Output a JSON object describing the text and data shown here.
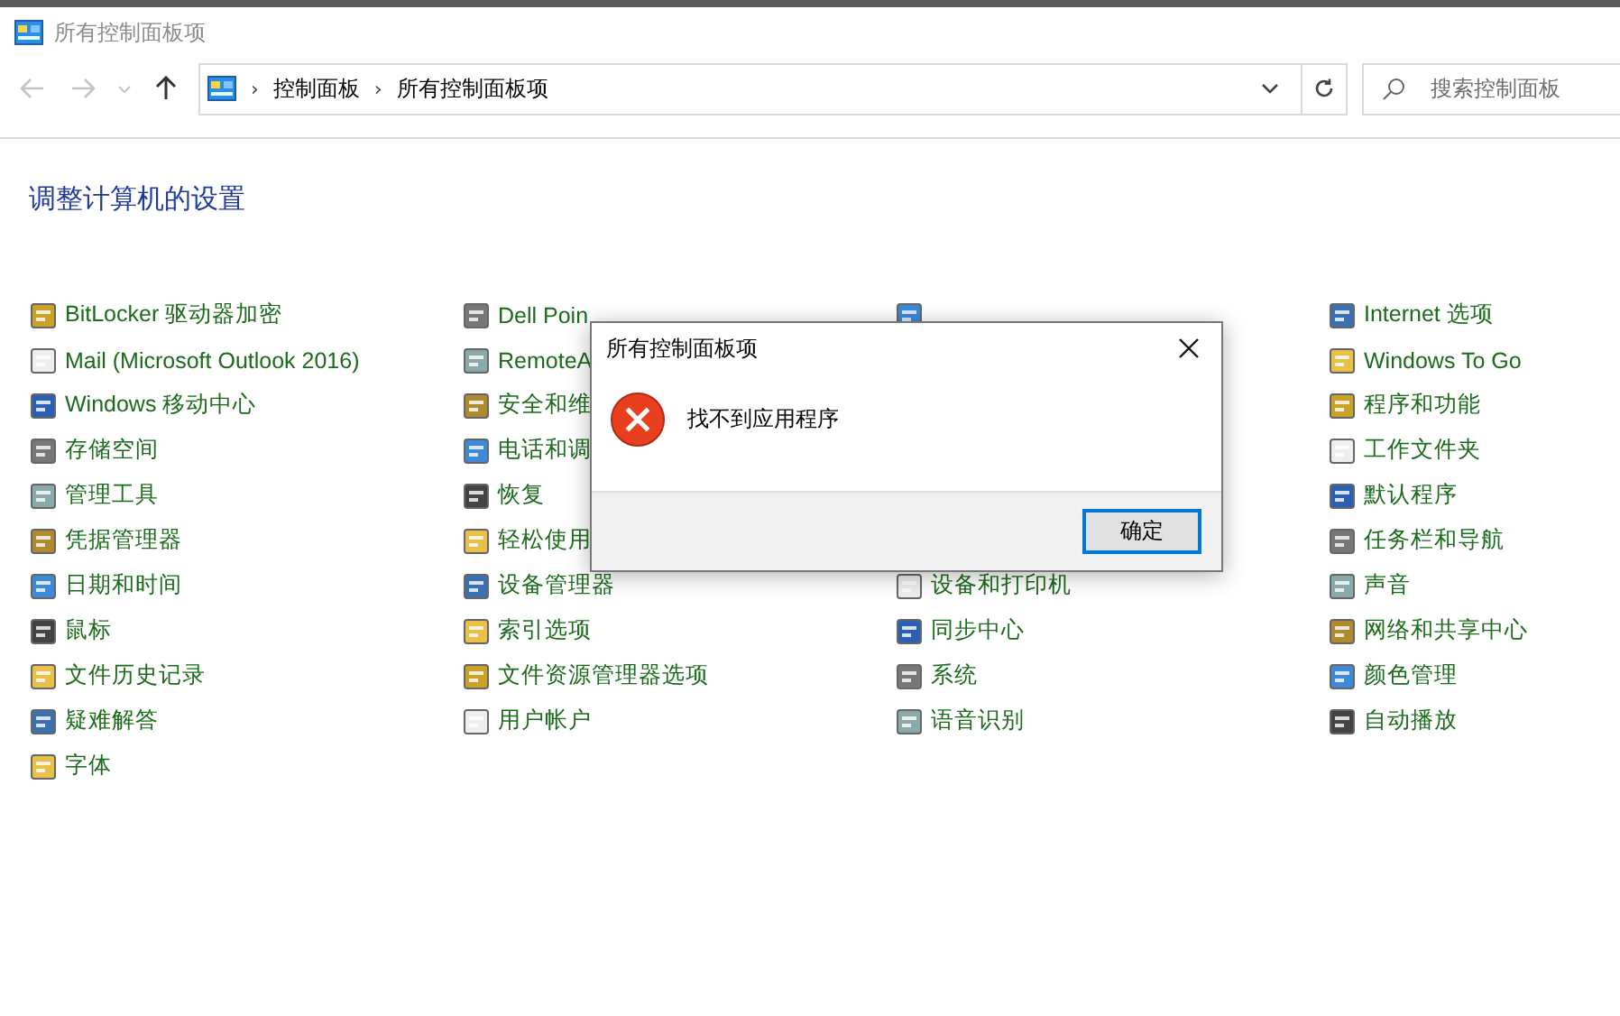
{
  "window": {
    "title": "所有控制面板项"
  },
  "address_bar": {
    "breadcrumbs": [
      {
        "separator": "›",
        "label": "控制面板"
      },
      {
        "separator": "›",
        "label": "所有控制面板项"
      }
    ]
  },
  "search": {
    "placeholder": "搜索控制面板"
  },
  "heading": "调整计算机的设置",
  "columns": [
    {
      "above": [
        {
          "label": "BitLocker 驱动器加密"
        },
        {
          "label": "Mail (Microsoft Outlook 2016)"
        },
        {
          "label": "Windows 移动中心"
        },
        {
          "label": "存储空间"
        },
        {
          "label": "管理工具"
        },
        {
          "label": "凭据管理器"
        },
        {
          "label": "日期和时间"
        },
        {
          "label": "鼠标"
        },
        {
          "label": "文件历史记录"
        },
        {
          "label": "疑难解答"
        },
        {
          "label": "字体"
        }
      ]
    },
    {
      "above": [
        {
          "label": "Dell Poin"
        },
        {
          "label": "RemoteA"
        },
        {
          "label": "安全和维"
        },
        {
          "label": "电话和调"
        },
        {
          "label": "恢复"
        },
        {
          "label": "轻松使用"
        },
        {
          "label": "设备管理器"
        },
        {
          "label": "索引选项"
        },
        {
          "label": "文件资源管理器选项"
        },
        {
          "label": "用户帐户"
        }
      ]
    },
    {
      "above": [
        {
          "kind": "icon_only"
        }
      ],
      "below": [
        {
          "label": "设备和打印机"
        },
        {
          "label": "同步中心"
        },
        {
          "label": "系统"
        },
        {
          "label": "语音识别"
        }
      ]
    },
    {
      "above": [
        {
          "label": "Internet 选项"
        },
        {
          "label": "Windows To Go"
        },
        {
          "label": "程序和功能"
        },
        {
          "label": "工作文件夹"
        },
        {
          "label": "默认程序"
        },
        {
          "label": "任务栏和导航"
        },
        {
          "label": "声音"
        },
        {
          "label": "网络和共享中心"
        },
        {
          "label": "颜色管理"
        },
        {
          "label": "自动播放"
        }
      ]
    }
  ],
  "dialog": {
    "title": "所有控制面板项",
    "message": "找不到应用程序",
    "buttons": [
      {
        "label": "确定",
        "selected": true
      }
    ]
  }
}
